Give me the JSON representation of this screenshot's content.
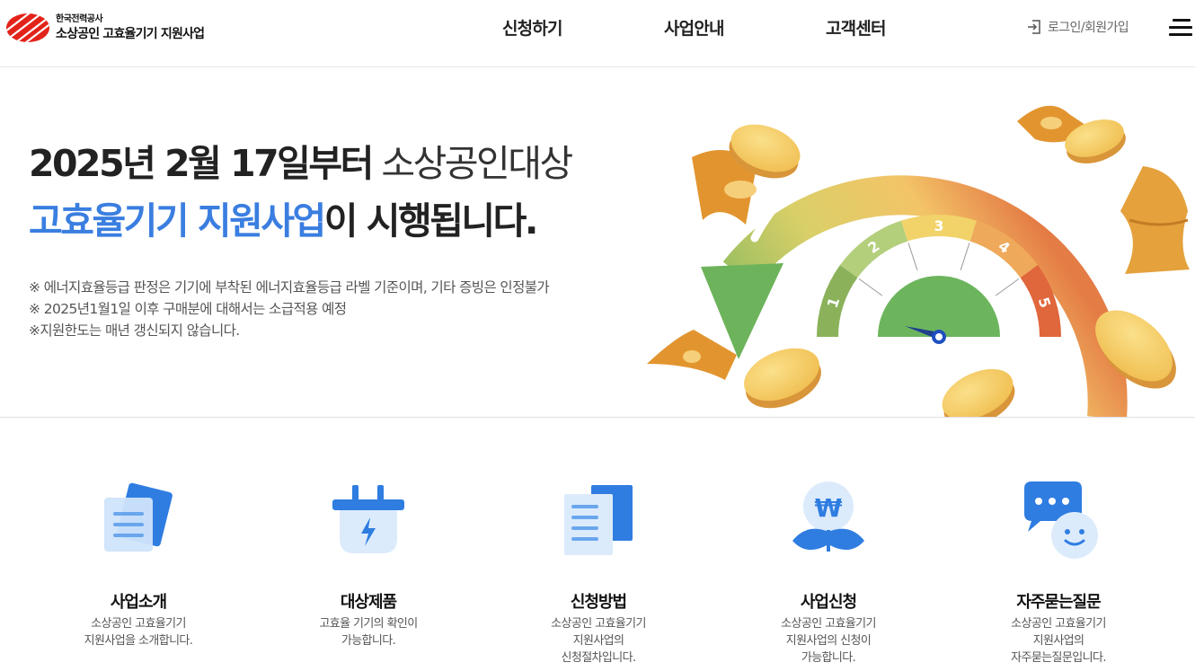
{
  "header": {
    "org_name": "한국전력공사",
    "site_title": "소상공인 고효율기기 지원사업",
    "nav": [
      {
        "label": "신청하기"
      },
      {
        "label": "사업안내"
      },
      {
        "label": "고객센터"
      }
    ],
    "login_label": "로그인/회원가입",
    "login_icon": "login-icon",
    "menu_icon": "hamburger-menu-icon"
  },
  "hero": {
    "headline_line1_bold": "2025년 2월 17일부터",
    "headline_line1_light": " 소상공인대상",
    "headline_line2_blue": "고효율기기 지원사업",
    "headline_line2_rest": "이 시행됩니다.",
    "notes": [
      "※ 에너지효율등급 판정은 기기에 부착된 에너지효율등급 라벨 기준이며, 기타 증빙은 인정불가",
      "※ 2025년1월1일 이후 구매분에 대해서는 소급적용 예정",
      "※지원한도는 매년 갱신되지 않습니다."
    ],
    "gauge_labels": [
      "1",
      "2",
      "3",
      "4",
      "5"
    ]
  },
  "services": [
    {
      "title": "사업소개",
      "desc": "소상공인 고효율기기\n지원사업을 소개합니다.",
      "icon": "document-card-icon"
    },
    {
      "title": "대상제품",
      "desc": "고효율 기기의 확인이\n가능합니다.",
      "icon": "plug-icon"
    },
    {
      "title": "신청방법",
      "desc": "소상공인 고효율기기\n지원사업의\n신청절차입니다.",
      "icon": "documents-icon"
    },
    {
      "title": "사업신청",
      "desc": "소상공인 고효율기기\n지원사업의 신청이\n가능합니다.",
      "icon": "won-plant-icon"
    },
    {
      "title": "자주묻는질문",
      "desc": "소상공인 고효율기기\n지원사업의\n자주묻는질문입니다.",
      "icon": "chat-bubble-icon"
    }
  ],
  "colors": {
    "accent_blue": "#3a7ee0",
    "brand_red": "#e2231a",
    "gauge": [
      "#8bb25a",
      "#b3cf7c",
      "#f2d36a",
      "#efa95a",
      "#e0663c"
    ]
  }
}
